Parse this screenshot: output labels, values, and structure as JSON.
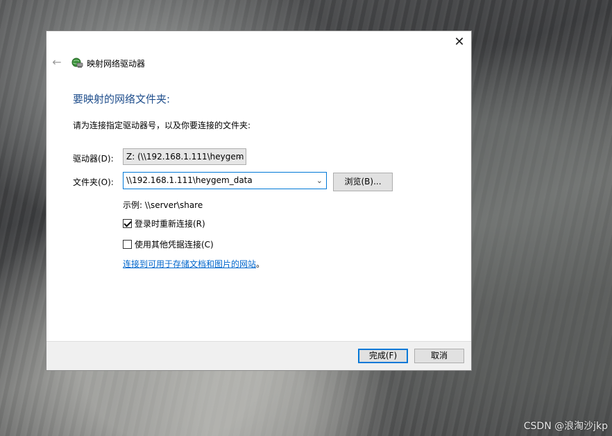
{
  "window": {
    "title": "映射网络驱动器",
    "close_symbol": "✕",
    "back_symbol": "←"
  },
  "content": {
    "heading": "要映射的网络文件夹:",
    "instruction": "请为连接指定驱动器号，以及你要连接的文件夹:",
    "drive_label": "驱动器(D):",
    "drive_value": "Z: (\\\\192.168.1.111\\heygem",
    "folder_label": "文件夹(O):",
    "folder_value": "\\\\192.168.1.111\\heygem_data",
    "browse_label": "浏览(B)...",
    "example": "示例: \\\\server\\share",
    "reconnect_label": "登录时重新连接(R)",
    "reconnect_checked": true,
    "other_credentials_label": "使用其他凭据连接(C)",
    "other_credentials_checked": false,
    "link_text": "连接到可用于存储文档和图片的网站",
    "link_suffix": "。"
  },
  "footer": {
    "finish_label": "完成(F)",
    "cancel_label": "取消"
  },
  "watermark": "CSDN @浪淘沙jkp",
  "colors": {
    "heading": "#1f4e8c",
    "link": "#0066cc",
    "focus": "#0078d7"
  },
  "icons": {
    "close": "close-icon",
    "back": "back-arrow-icon",
    "title": "network-drive-icon",
    "chevron": "chevron-down-icon"
  }
}
